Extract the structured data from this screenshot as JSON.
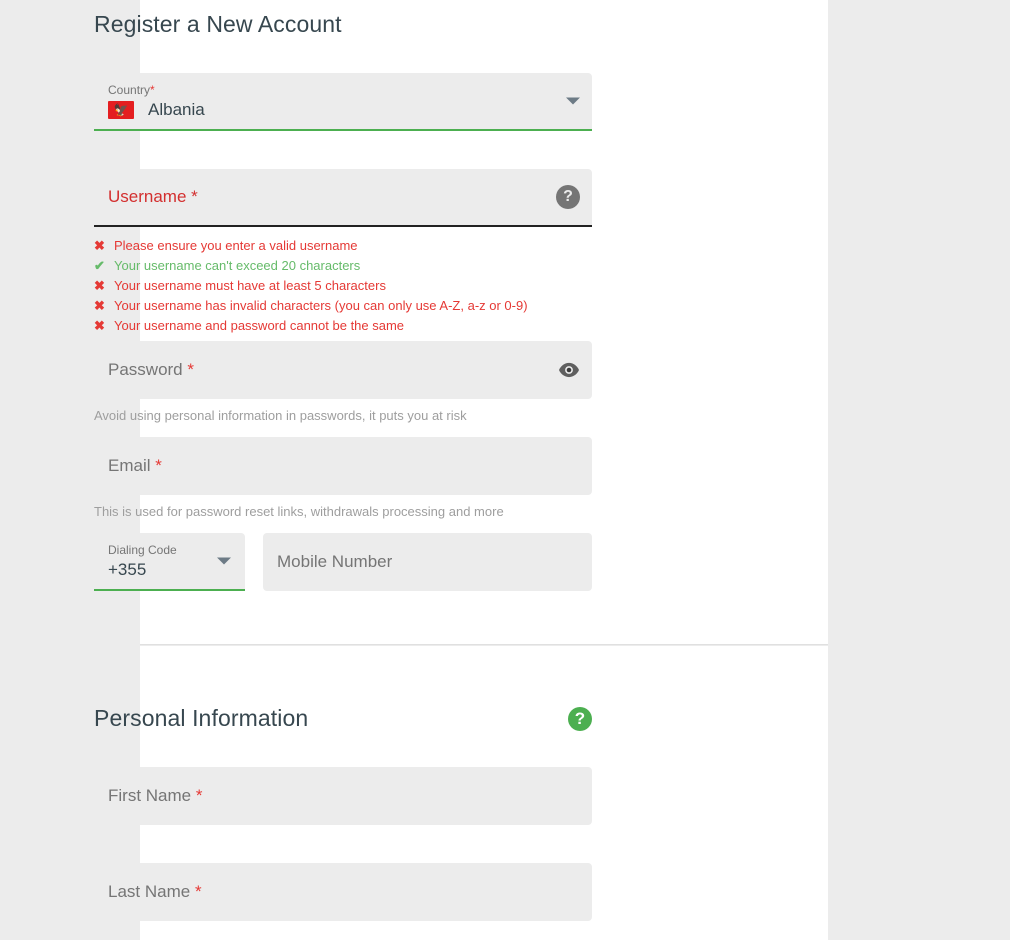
{
  "register": {
    "title": "Register a New Account",
    "country": {
      "label": "Country",
      "required": "*",
      "value": "Albania",
      "flag_icon": "albania-flag-icon",
      "dropdown_icon": "chevron-down-icon"
    },
    "username": {
      "placeholder": "Username",
      "required": "*",
      "value": "",
      "help_icon": "help-circle-icon",
      "validations": [
        {
          "status": "fail",
          "mark": "✖",
          "text": "Please ensure you enter a valid username"
        },
        {
          "status": "pass",
          "mark": "✔",
          "text": "Your username can't exceed 20 characters"
        },
        {
          "status": "fail",
          "mark": "✖",
          "text": "Your username must have at least 5 characters"
        },
        {
          "status": "fail",
          "mark": "✖",
          "text": "Your username has invalid characters (you can only use A-Z, a-z or 0-9)"
        },
        {
          "status": "fail",
          "mark": "✖",
          "text": "Your username and password cannot be the same"
        }
      ]
    },
    "password": {
      "placeholder": "Password",
      "required": "*",
      "value": "",
      "reveal_icon": "eye-icon",
      "helper": "Avoid using personal information in passwords, it puts you at risk"
    },
    "email": {
      "placeholder": "Email",
      "required": "*",
      "value": "",
      "helper": "This is used for password reset links, withdrawals processing and more"
    },
    "dialing_code": {
      "label": "Dialing Code",
      "value": "+355",
      "dropdown_icon": "chevron-down-icon"
    },
    "mobile_number": {
      "placeholder": "Mobile Number",
      "value": ""
    }
  },
  "personal": {
    "title": "Personal Information",
    "help_icon": "help-circle-icon",
    "first_name": {
      "placeholder": "First Name",
      "required": "*",
      "value": ""
    },
    "last_name": {
      "placeholder": "Last Name",
      "required": "*",
      "value": ""
    }
  },
  "colors": {
    "page_background": "#ececec",
    "card_background": "#ffffff",
    "field_background": "#ececec",
    "accent_green": "#4caf50",
    "error_red": "#e53935",
    "focus_underline": "#222222",
    "heading_text": "#37474f",
    "placeholder_text": "#757575",
    "helper_text": "#9e9e9e"
  }
}
